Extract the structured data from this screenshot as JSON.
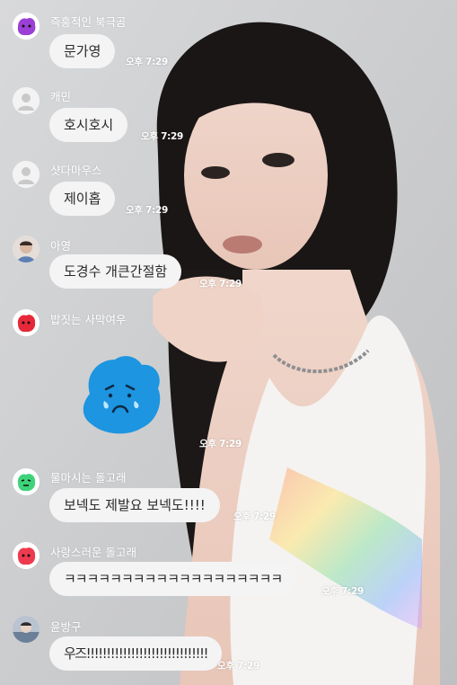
{
  "colors": {
    "bubble_bg": "#f4f4f5",
    "text_white": "#ffffff",
    "sticker_blue": "#1d95e0"
  },
  "messages": [
    {
      "nickname": "즉흥적인 북극곰",
      "text": "문가영",
      "time": "오후 7:29",
      "avatar_icon": "purple-character-avatar-icon"
    },
    {
      "nickname": "캐민",
      "text": "호시호시",
      "time": "오후 7:29",
      "avatar_icon": "default-profile-avatar-icon"
    },
    {
      "nickname": "샷다마우스",
      "text": "제이홉",
      "time": "오후 7:29",
      "avatar_icon": "default-profile-avatar-icon"
    },
    {
      "nickname": "아영",
      "text": "도경수 개큰간절함",
      "time": "오후 7:29",
      "avatar_icon": "photo-avatar-icon"
    },
    {
      "nickname": "밥짓는 사막여우",
      "sticker": "crying-blue-blob-sticker",
      "time": "오후 7:29",
      "avatar_icon": "red-character-avatar-icon"
    },
    {
      "nickname": "물마시는 돌고래",
      "text": "보넥도 제발요 보넥도!!!!",
      "time": "오후 7:29",
      "avatar_icon": "green-character-avatar-icon"
    },
    {
      "nickname": "사랑스러운 돌고래",
      "text": "ㅋㅋㅋㅋㅋㅋㅋㅋㅋㅋㅋㅋㅋㅋㅋㅋㅋㅋㅋ",
      "time": "오후 7:29",
      "avatar_icon": "red-character-avatar-icon"
    },
    {
      "nickname": "윤방구",
      "text": "우즈!!!!!!!!!!!!!!!!!!!!!!!!!!!!!!",
      "time": "오후 7:29",
      "avatar_icon": "photo-avatar-icon"
    }
  ]
}
